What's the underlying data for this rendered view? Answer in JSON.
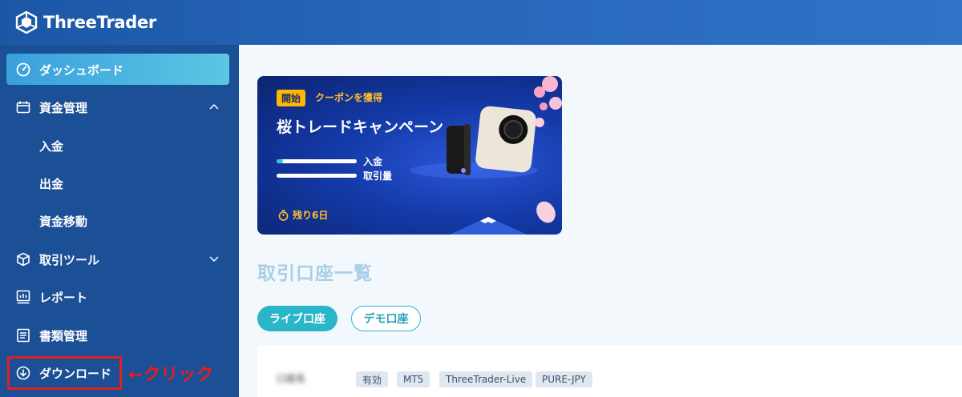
{
  "app": {
    "brand": "ThreeTrader"
  },
  "sidebar": {
    "items": [
      {
        "label": "ダッシュボード",
        "icon": "gauge-icon",
        "active": true
      },
      {
        "label": "資金管理",
        "icon": "wallet-icon",
        "expanded": true
      },
      {
        "label": "入金",
        "sub": true
      },
      {
        "label": "出金",
        "sub": true
      },
      {
        "label": "資金移動",
        "sub": true
      },
      {
        "label": "取引ツール",
        "icon": "box-icon",
        "expanded": false
      },
      {
        "label": "レポート",
        "icon": "report-icon"
      },
      {
        "label": "書類管理",
        "icon": "document-icon"
      },
      {
        "label": "ダウンロード",
        "icon": "download-icon"
      }
    ]
  },
  "annotation": {
    "text": "←クリック",
    "color": "#e02020"
  },
  "banner": {
    "badge": "開始",
    "coupon": "クーポンを獲得",
    "title": "桜トレードキャンペーン",
    "progress": [
      {
        "label": "入金",
        "value": 0.08
      },
      {
        "label": "取引量",
        "value": 0
      }
    ],
    "remaining": "残り6日"
  },
  "main": {
    "section_title": "取引口座一覧",
    "tabs": [
      {
        "label": "ライブ口座",
        "active": true
      },
      {
        "label": "デモ口座",
        "active": false
      }
    ],
    "account": {
      "name": "口座名",
      "tags": [
        "有効",
        "MT5",
        "ThreeTrader-Live",
        "PURE-JPY"
      ]
    }
  },
  "colors": {
    "header": "#1c57a6",
    "sidebar": "#1b4f96",
    "active_nav": "#3aa0dd",
    "accent": "#2bb5c9",
    "highlight": "#e02020"
  }
}
